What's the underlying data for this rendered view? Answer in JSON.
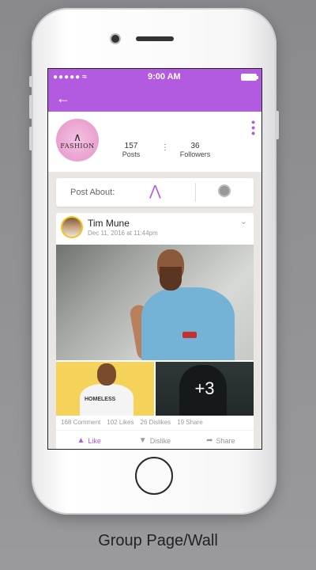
{
  "status_bar": {
    "signal": "●●●●● ",
    "time": "9:00 AM"
  },
  "group": {
    "logo_text": "FASHION",
    "posts": {
      "count": "157",
      "label": "Posts"
    },
    "followers": {
      "count": "36",
      "label": "Followers"
    }
  },
  "post_about": {
    "label": "Post About:"
  },
  "post": {
    "author": "Tim Mune",
    "timestamp": "Dec 11, 2016 at 11:44pm",
    "more_photos": "+3",
    "thumb_text": "HOMELESS",
    "stats": {
      "comments": "168 Comment",
      "likes": "102 Likes",
      "dislikes": "26 Dislikes",
      "shares": "19 Share"
    },
    "actions": {
      "like": "Like",
      "dislike": "Dislike",
      "share": "Share"
    }
  },
  "caption": "Group Page/Wall",
  "colors": {
    "accent": "#b25ae0",
    "avatar_ring": "#f0c419"
  },
  "icons": [
    "back-arrow-icon",
    "hanger-icon",
    "globe-icon",
    "menu-dots-icon",
    "chevron-down-icon",
    "like-icon",
    "dislike-icon",
    "share-icon",
    "wifi-icon",
    "battery-icon"
  ]
}
